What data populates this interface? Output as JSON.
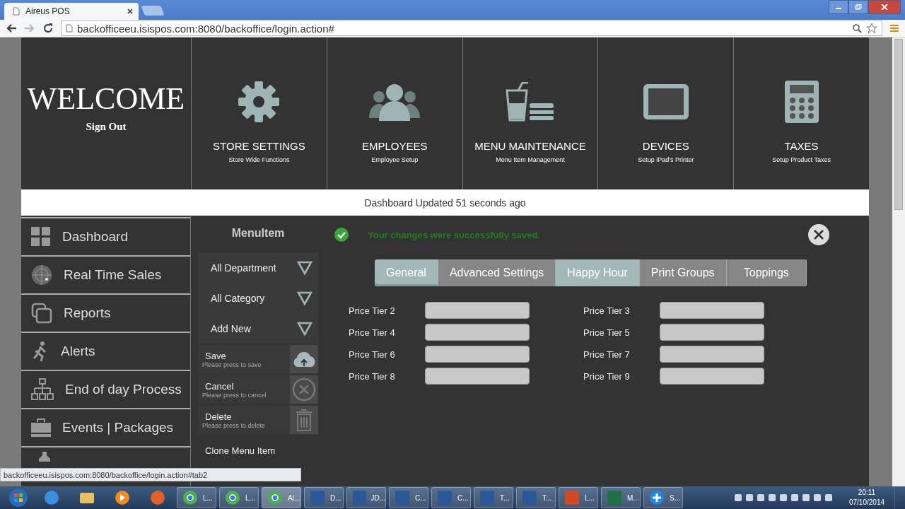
{
  "browser": {
    "tab_title": "Aireus POS",
    "url": "backofficeeu.isispos.com:8080/backoffice/login.action#"
  },
  "header": {
    "welcome": "WELCOME",
    "sign_out": "Sign Out",
    "tiles": [
      {
        "kind": "gear",
        "title": "STORE SETTINGS",
        "subtitle": "Store Wide Functions"
      },
      {
        "kind": "people",
        "title": "EMPLOYEES",
        "subtitle": "Employee Setup"
      },
      {
        "kind": "menu",
        "title": "MENU MAINTENANCE",
        "subtitle": "Menu Item Management"
      },
      {
        "kind": "tablet",
        "title": "DEVICES",
        "subtitle": "Setup iPad's Printer"
      },
      {
        "kind": "calculator",
        "title": "TAXES",
        "subtitle": "Setup Product Taxes"
      }
    ]
  },
  "status": "Dashboard Updated 51 seconds ago",
  "sidebar": {
    "items": [
      {
        "kind": "grid",
        "label": "Dashboard"
      },
      {
        "kind": "radar",
        "label": "Real Time Sales"
      },
      {
        "kind": "copy",
        "label": "Reports"
      },
      {
        "kind": "runner",
        "label": "Alerts"
      },
      {
        "kind": "tree",
        "label": "End of day Process"
      },
      {
        "kind": "briefcase",
        "label": "Events | Packages"
      }
    ]
  },
  "panel": {
    "title": "MenuItem",
    "dropdowns": [
      "All Department",
      "All Category",
      "Add New"
    ],
    "actions": [
      {
        "kind": "save",
        "label": "Save",
        "hint": "Please press to save"
      },
      {
        "kind": "cancel",
        "label": "Cancel",
        "hint": "Please press to cancel"
      },
      {
        "kind": "delete",
        "label": "Delete",
        "hint": "Please press to delete"
      },
      {
        "kind": "plain",
        "label": "Clone Menu Item"
      }
    ]
  },
  "message": "Your changes were successfully saved.",
  "tabs": [
    {
      "label": "General",
      "selected": true,
      "hovered": false
    },
    {
      "label": "Advanced Settings",
      "selected": false,
      "hovered": false
    },
    {
      "label": "Happy Hour",
      "selected": false,
      "hovered": true
    },
    {
      "label": "Print Groups",
      "selected": false,
      "hovered": false
    },
    {
      "label": "Toppings",
      "selected": false,
      "hovered": false
    }
  ],
  "fields": [
    {
      "label": "Price Tier 2"
    },
    {
      "label": "Price Tier 3"
    },
    {
      "label": "Price Tier 4"
    },
    {
      "label": "Price Tier 5"
    },
    {
      "label": "Price Tier 6"
    },
    {
      "label": "Price Tier 7"
    },
    {
      "label": "Price Tier 8"
    },
    {
      "label": "Price Tier 9"
    }
  ],
  "link_preview": "backofficeeu.isispos.com:8080/backoffice/login.action#tab2",
  "taskbar": {
    "items": [
      {
        "kind": "ie",
        "selected": false
      },
      {
        "kind": "folder",
        "selected": false
      },
      {
        "kind": "media",
        "selected": false
      },
      {
        "kind": "firefox",
        "selected": false
      },
      {
        "kind": "chrome",
        "label": "L...",
        "selected": false
      },
      {
        "kind": "chrome",
        "label": "L...",
        "selected": false
      },
      {
        "kind": "chrome",
        "label": "Ai...",
        "selected": true
      },
      {
        "kind": "word",
        "label": "D...",
        "selected": false
      },
      {
        "kind": "word",
        "label": "JD...",
        "selected": false
      },
      {
        "kind": "word",
        "label": "C...",
        "selected": false
      },
      {
        "kind": "word",
        "label": "C...",
        "selected": false
      },
      {
        "kind": "word",
        "label": "T...",
        "selected": false
      },
      {
        "kind": "word",
        "label": "T...",
        "selected": false
      },
      {
        "kind": "powerpoint",
        "label": "L...",
        "selected": false
      },
      {
        "kind": "excel",
        "label": "M...",
        "selected": false
      },
      {
        "kind": "plus",
        "label": "S...",
        "selected": false
      }
    ],
    "time": "20:11",
    "date": "07/10/2014"
  }
}
